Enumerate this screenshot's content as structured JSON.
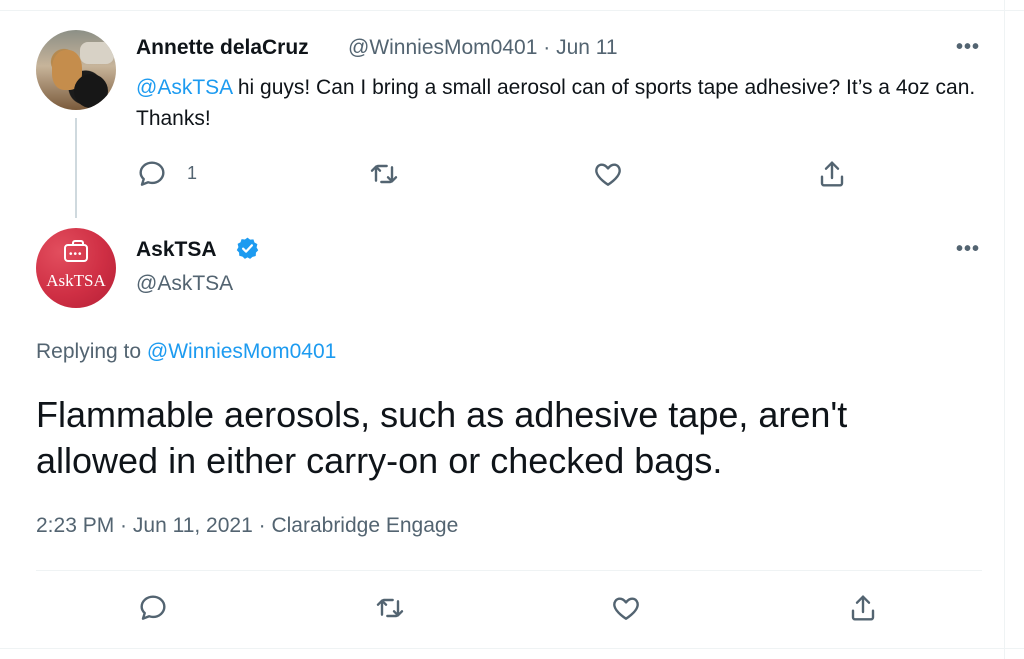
{
  "tweet1": {
    "author_name": "Annette delaCruz",
    "author_handle": "@WinniesMom0401",
    "date": "Jun 11",
    "mention": "@AskTSA",
    "text_rest": " hi guys! Can I bring a small aerosol can of sports tape adhesive? It’s a 4oz can. Thanks!",
    "reply_count": "1",
    "more": "•••"
  },
  "tweet2": {
    "avatar_label": "AskTSA",
    "author_name": "AskTSA",
    "author_handle": "@AskTSA",
    "more": "•••",
    "replying_prefix": "Replying to",
    "replying_handle": "@WinniesMom0401",
    "text": "Flammable aerosols, such as adhesive tape, aren't allowed in either carry-on or checked bags.",
    "time": "2:23 PM",
    "date": "Jun 11, 2021",
    "source": "Clarabridge Engage"
  },
  "icons": {
    "reply": "reply-icon",
    "retweet": "retweet-icon",
    "like": "heart-icon",
    "share": "share-icon",
    "verified": "verified-badge-icon"
  },
  "colors": {
    "link": "#1d9bf0",
    "muted": "#536471",
    "text": "#0f1419",
    "tsa_brand": "#cf2f44",
    "verified": "#1d9bf0"
  }
}
